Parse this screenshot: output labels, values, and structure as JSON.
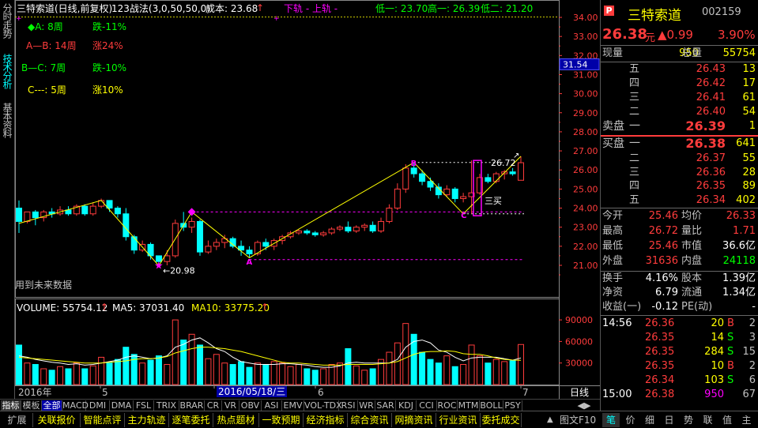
{
  "left_tabs": [
    "分时走势",
    "技术分析",
    "基本资料"
  ],
  "header": {
    "title": "三特索道(日线,前复权)",
    "indicator": "123战法(3,0,50,50,0)",
    "cost": "成本: 23.68",
    "cost_arrow": "↑",
    "rail": "下轨 - 上轨 -",
    "low1": "低一: 23.70",
    "high1": "高一: 26.39",
    "low2": "低二: 21.20"
  },
  "waves": [
    {
      "label": "◆A: 8周",
      "change": "跌-11%",
      "color": "#00ff00"
    },
    {
      "label": "A—B: 14周",
      "change": "涨24%",
      "color": "#ff3c3c"
    },
    {
      "label": "B—C: 7周",
      "change": "跌-10%",
      "color": "#00ff00"
    },
    {
      "label": "C---: 5周",
      "change": "涨10%",
      "color": "#ffff00"
    }
  ],
  "price_axis": [
    "34.00",
    "33.00",
    "32.00",
    "31.00",
    "30.00",
    "29.00",
    "28.00",
    "27.00",
    "26.00",
    "25.00",
    "24.00",
    "23.00",
    "22.00",
    "21.00"
  ],
  "price_marker": "31.54",
  "vol_axis": [
    "90000",
    "60000",
    "30000"
  ],
  "volume_header": {
    "vol": "VOLUME: 55754.12",
    "ma5": "MA5: 37031.40",
    "ma10": "MA10: 33775.20",
    "arrow": "↑"
  },
  "annotations": {
    "future_data": "用到未来数据",
    "low_price": "20.98",
    "high_price": "26.72",
    "buy_signal": "三买",
    "point_a": "A",
    "point_b": "B",
    "point_c": "C"
  },
  "date_axis": {
    "year": "2016年",
    "m5": "5",
    "cursor_date": "2016/05/18/三",
    "m6": "6",
    "m7": "7",
    "period": "日线"
  },
  "indicator_tabs": [
    "指标",
    "模板",
    "全部",
    "MACD",
    "DMI",
    "DMA",
    "FSL",
    "TRIX",
    "BRAR",
    "CR",
    "VR",
    "OBV",
    "ASI",
    "EMV",
    "VOL-TDX",
    "RSI",
    "WR",
    "SAR",
    "KDJ",
    "CCI",
    "ROC",
    "MTM",
    "BOLL",
    "PSY"
  ],
  "bottom_tabs": [
    "扩展",
    "关联报价",
    "智能点评",
    "主力轨迹",
    "逐笔委托",
    "热点题材",
    "一致预期",
    "经济指标",
    "综合资讯",
    "网摘资讯",
    "行业资讯",
    "委托成交"
  ],
  "bottom_right": "图文F10",
  "quote_tabs": [
    "笔",
    "价",
    "细",
    "日",
    "势",
    "联",
    "值",
    "主"
  ],
  "quote": {
    "flag": "P",
    "name": "三特索道",
    "code": "002159",
    "price": "26.38",
    "unit": "元",
    "change": "▲0.99",
    "change_pct": "3.90%",
    "current_label": "现量",
    "current_vol": "950",
    "total_label": "总量",
    "total_vol": "55754",
    "asks": [
      {
        "level": "五",
        "price": "26.43",
        "vol": "13"
      },
      {
        "level": "四",
        "price": "26.42",
        "vol": "17"
      },
      {
        "level": "三",
        "price": "26.41",
        "vol": "61"
      },
      {
        "level": "二",
        "price": "26.40",
        "vol": "54"
      }
    ],
    "ask1": {
      "label": "卖盘",
      "level": "一",
      "price": "26.39",
      "vol": "1"
    },
    "bid1": {
      "label": "买盘",
      "level": "一",
      "price": "26.38",
      "vol": "641"
    },
    "bids": [
      {
        "level": "二",
        "price": "26.37",
        "vol": "55"
      },
      {
        "level": "三",
        "price": "26.36",
        "vol": "28"
      },
      {
        "level": "四",
        "price": "26.35",
        "vol": "89"
      },
      {
        "level": "五",
        "price": "26.34",
        "vol": "402"
      }
    ],
    "stats": [
      {
        "l1": "今开",
        "v1": "25.46",
        "c1": "#ff3c3c",
        "l2": "均价",
        "v2": "26.33",
        "c2": "#ff3c3c"
      },
      {
        "l1": "最高",
        "v1": "26.72",
        "c1": "#ff3c3c",
        "l2": "量比",
        "v2": "1.71",
        "c2": "#ff3c3c"
      },
      {
        "l1": "最低",
        "v1": "25.46",
        "c1": "#ff3c3c",
        "l2": "市值",
        "v2": "36.6亿",
        "c2": "#ffffff"
      },
      {
        "l1": "外盘",
        "v1": "31636",
        "c1": "#ff3c3c",
        "l2": "内盘",
        "v2": "24118",
        "c2": "#00ff00"
      }
    ],
    "finance": [
      {
        "l1": "换手",
        "v1": "4.16%",
        "l2": "股本",
        "v2": "1.39亿"
      },
      {
        "l1": "净资",
        "v1": "6.79",
        "l2": "流通",
        "v2": "1.34亿"
      },
      {
        "l1": "收益(一)",
        "v1": "-0.12",
        "l2": "PE(动)",
        "v2": "-"
      }
    ],
    "ticks": [
      {
        "time": "14:56",
        "price": "26.36",
        "vol": "20",
        "side": "B",
        "count": "2"
      },
      {
        "time": "",
        "price": "26.35",
        "vol": "14",
        "side": "S",
        "count": "3"
      },
      {
        "time": "",
        "price": "26.35",
        "vol": "284",
        "side": "S",
        "count": "15"
      },
      {
        "time": "",
        "price": "26.35",
        "vol": "10",
        "side": "B",
        "count": "2"
      },
      {
        "time": "",
        "price": "26.34",
        "vol": "103",
        "side": "S",
        "count": "6"
      },
      {
        "time": "15:00",
        "price": "26.38",
        "vol": "950",
        "side": "",
        "count": "67"
      }
    ]
  },
  "colors": {
    "up": "#ff3c3c",
    "down": "#00ffff",
    "neutral": "#ffffff",
    "zigzag": "#ffff00",
    "magenta": "#ff00ff"
  },
  "chart_data": {
    "type": "candlestick",
    "price_range": [
      20.5,
      34.5
    ],
    "volume_range": [
      0,
      100000
    ],
    "candles": [
      [
        24.0,
        24.4,
        22.7,
        23.3
      ],
      [
        23.3,
        23.8,
        23.2,
        23.8
      ],
      [
        23.8,
        23.9,
        23.1,
        23.5
      ],
      [
        23.5,
        23.9,
        23.3,
        23.8
      ],
      [
        23.8,
        24.0,
        23.5,
        23.7
      ],
      [
        23.7,
        24.1,
        23.6,
        23.9
      ],
      [
        23.9,
        24.1,
        23.6,
        23.7
      ],
      [
        23.7,
        24.2,
        23.6,
        24.1
      ],
      [
        24.1,
        24.2,
        23.6,
        23.7
      ],
      [
        23.7,
        24.3,
        23.6,
        24.1
      ],
      [
        24.1,
        24.5,
        24.0,
        24.4
      ],
      [
        24.4,
        24.4,
        23.8,
        24.0
      ],
      [
        24.0,
        24.1,
        23.5,
        23.7
      ],
      [
        23.7,
        24.0,
        22.3,
        22.5
      ],
      [
        22.5,
        22.6,
        21.6,
        21.8
      ],
      [
        21.8,
        22.3,
        21.7,
        22.1
      ],
      [
        22.1,
        22.2,
        21.3,
        21.5
      ],
      [
        21.5,
        21.5,
        20.98,
        21.2
      ],
      [
        21.2,
        21.8,
        21.0,
        21.5
      ],
      [
        21.5,
        23.4,
        21.4,
        23.2
      ],
      [
        23.2,
        23.8,
        22.8,
        23.0
      ],
      [
        23.0,
        23.5,
        22.7,
        23.3
      ],
      [
        23.3,
        23.4,
        21.5,
        21.7
      ],
      [
        21.7,
        22.3,
        21.6,
        22.0
      ],
      [
        22.0,
        22.4,
        21.8,
        22.2
      ],
      [
        22.2,
        22.6,
        21.9,
        22.4
      ],
      [
        22.4,
        22.5,
        21.9,
        22.0
      ],
      [
        22.0,
        22.3,
        21.5,
        21.8
      ],
      [
        21.8,
        22.0,
        21.4,
        21.6
      ],
      [
        21.6,
        22.3,
        21.5,
        22.2
      ],
      [
        22.2,
        22.4,
        21.8,
        22.0
      ],
      [
        22.0,
        22.4,
        21.8,
        22.3
      ],
      [
        22.3,
        22.6,
        22.1,
        22.5
      ],
      [
        22.5,
        22.8,
        22.4,
        22.7
      ],
      [
        22.7,
        22.9,
        22.6,
        22.8
      ],
      [
        22.8,
        22.9,
        22.6,
        22.7
      ],
      [
        22.7,
        22.8,
        22.5,
        22.6
      ],
      [
        22.6,
        22.8,
        22.5,
        22.7
      ],
      [
        22.7,
        23.0,
        22.6,
        22.9
      ],
      [
        22.9,
        23.1,
        22.8,
        23.0
      ],
      [
        23.0,
        23.3,
        22.7,
        22.8
      ],
      [
        22.8,
        23.1,
        22.7,
        23.0
      ],
      [
        23.0,
        23.2,
        22.8,
        23.1
      ],
      [
        23.1,
        23.3,
        22.7,
        22.8
      ],
      [
        22.8,
        23.5,
        22.7,
        23.3
      ],
      [
        23.3,
        24.2,
        23.2,
        24.0
      ],
      [
        24.0,
        25.3,
        23.9,
        25.0
      ],
      [
        25.0,
        26.3,
        24.8,
        26.1
      ],
      [
        26.1,
        26.39,
        25.6,
        25.8
      ],
      [
        25.8,
        26.0,
        25.2,
        25.4
      ],
      [
        25.4,
        25.6,
        24.9,
        25.1
      ],
      [
        25.1,
        25.3,
        24.5,
        24.7
      ],
      [
        24.7,
        25.2,
        24.6,
        25.0
      ],
      [
        25.0,
        25.1,
        24.3,
        24.5
      ],
      [
        24.5,
        24.8,
        24.3,
        24.6
      ],
      [
        24.6,
        26.5,
        23.7,
        24.8
      ],
      [
        24.8,
        25.8,
        24.7,
        25.6
      ],
      [
        25.6,
        25.8,
        25.3,
        25.4
      ],
      [
        25.4,
        25.9,
        25.3,
        25.8
      ],
      [
        25.8,
        26.0,
        25.5,
        25.9
      ],
      [
        25.9,
        26.1,
        25.7,
        25.8
      ],
      [
        25.46,
        26.72,
        25.46,
        26.38
      ]
    ],
    "volumes": [
      55000,
      30000,
      28000,
      22000,
      20000,
      25000,
      22000,
      30000,
      22000,
      26000,
      38000,
      30000,
      35000,
      52000,
      42000,
      30000,
      34000,
      40000,
      28000,
      90000,
      62000,
      70000,
      55000,
      36000,
      42000,
      30000,
      28000,
      32000,
      24000,
      30000,
      28000,
      32000,
      30000,
      25000,
      28000,
      22000,
      20000,
      22000,
      28000,
      30000,
      50000,
      26000,
      20000,
      22000,
      35000,
      45000,
      58000,
      85000,
      70000,
      45000,
      35000,
      30000,
      40000,
      25000,
      28000,
      55000,
      40000,
      30000,
      35000,
      32000,
      33000,
      55754
    ],
    "ma5": [
      40000,
      38000,
      35000,
      33000,
      31000,
      30000,
      28000,
      29000,
      27000,
      28000,
      30000,
      32000,
      34000,
      38000,
      40000,
      38000,
      36000,
      37000,
      40000,
      52000,
      56000,
      62000,
      65000,
      58000,
      50000,
      46000,
      38000,
      32000,
      30000,
      28000,
      28000,
      28000,
      29000,
      29000,
      28000,
      27000,
      25000,
      24000,
      24000,
      26000,
      30000,
      31000,
      30000,
      30000,
      30000,
      30000,
      35000,
      52000,
      60000,
      62000,
      58000,
      48000,
      45000,
      38000,
      33000,
      37000,
      38000,
      38000,
      38000,
      36000,
      34000,
      37031
    ],
    "ma10": [
      38000,
      37000,
      36000,
      35000,
      34000,
      33000,
      32000,
      31000,
      30000,
      30000,
      30000,
      31000,
      32000,
      33000,
      35000,
      36000,
      36000,
      37000,
      39000,
      44000,
      47000,
      50000,
      52000,
      52000,
      51000,
      50000,
      48000,
      46000,
      43000,
      40000,
      37000,
      34000,
      31000,
      30000,
      30000,
      29000,
      28000,
      27000,
      27000,
      27000,
      28000,
      28000,
      28000,
      28000,
      29000,
      30000,
      32000,
      37000,
      42000,
      45000,
      46000,
      46000,
      47000,
      46000,
      43000,
      42000,
      42000,
      40000,
      37000,
      35000,
      34000,
      33775
    ],
    "zigzag": [
      [
        0,
        23.2
      ],
      [
        10,
        24.4
      ],
      [
        17,
        20.98
      ],
      [
        21,
        23.8
      ],
      [
        28,
        21.4
      ],
      [
        48,
        26.39
      ],
      [
        54,
        23.7
      ],
      [
        61,
        26.72
      ]
    ]
  }
}
